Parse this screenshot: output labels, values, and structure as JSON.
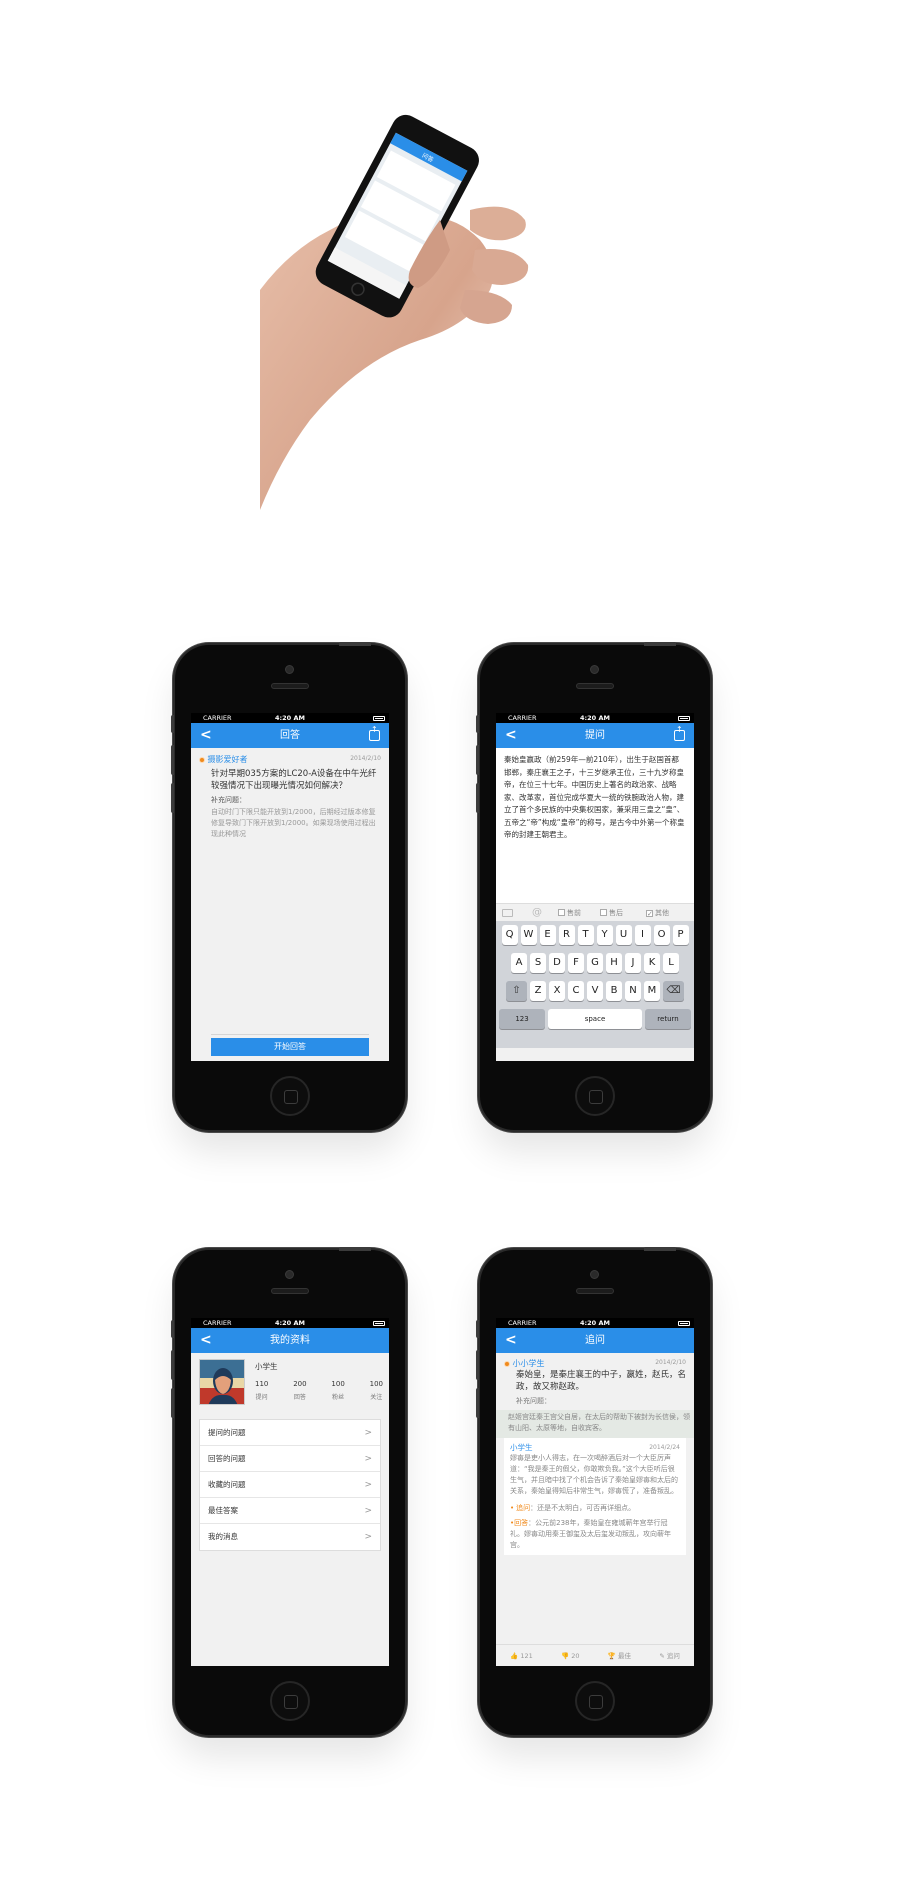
{
  "hero_phone": {
    "nav_title": "问答"
  },
  "status": {
    "carrier": "CARRIER",
    "time": "4:20 AM"
  },
  "screen_answer": {
    "nav_title": "回答",
    "user": "摄影爱好者",
    "date": "2014/2/10",
    "question": "针对早期035方案的LC20-A设备在中午光纤较强情况下出现曝光情况如何解决？",
    "supplement_label": "补充问题：",
    "supplement": "自动时门下限只能开放到1/2000，后期经过版本修复修复导致门下限开放到1/2000。如果现场使用过程出现此种情况",
    "start_button": "开始回答"
  },
  "screen_ask": {
    "nav_title": "提问",
    "body": "秦始皇嬴政（前259年—前210年），出生于赵国首都邯郸，秦庄襄王之子，十三岁继承王位，三十九岁称皇帝，在位三十七年。中国历史上著名的政治家、战略家、改革家，首位完成华夏大一统的铁腕政治人物，建立了首个多民族的中央集权国家，兼采用三皇之“皇”、五帝之“帝”构成“皇帝”的称号，是古今中外第一个称皇帝的封建王朝君主。",
    "options": [
      "售前",
      "售后",
      "其他"
    ],
    "checked_option": "其他",
    "keyboard": {
      "row1": [
        "Q",
        "W",
        "E",
        "R",
        "T",
        "Y",
        "U",
        "I",
        "O",
        "P"
      ],
      "row2": [
        "A",
        "S",
        "D",
        "F",
        "G",
        "H",
        "J",
        "K",
        "L"
      ],
      "row3": [
        "Z",
        "X",
        "C",
        "V",
        "B",
        "N",
        "M"
      ],
      "k123": "123",
      "space": "space",
      "return": "return"
    }
  },
  "screen_profile": {
    "nav_title": "我的资料",
    "name": "小学生",
    "stats": [
      {
        "value": "110",
        "label": "提问"
      },
      {
        "value": "200",
        "label": "回答"
      },
      {
        "value": "100",
        "label": "粉丝"
      },
      {
        "value": "100",
        "label": "关注"
      }
    ],
    "menu": [
      "提问的问题",
      "回答的问题",
      "收藏的问题",
      "最佳答案",
      "我的消息"
    ]
  },
  "screen_followup": {
    "nav_title": "追问",
    "user": "小小学生",
    "date": "2014/2/10",
    "question": "秦始皇，是秦庄襄王的中子，嬴姓，赵氏，名政，故又称赵政。",
    "supplement_label": "补充问题：",
    "supplement": "赵姬宫廷秦王宫父自居，在太后的帮助下被封为长信侯，领有山阳、太原等地，自收宾客。",
    "answer_user": "小学生",
    "answer_date": "2014/2/24",
    "answer": "嫪毐是吏小人得志，在一次喝醉酒后对一个大臣厉声道：“我是秦王的假父，你敢欺负我。”这个大臣听后很生气，并且暗中找了个机会告诉了秦始皇嫪毐和太后的关系，秦始皇得知后非常生气，嫪毐慌了，准备叛乱。",
    "follow_tag": "追问",
    "follow_text": "：还是不太明白，可否再详细点。",
    "reply_tag": "回答",
    "reply_text": "：公元前238年，秦始皇在雍城蕲年宫举行冠礼。嫪毐动用秦王御玺及太后玺发动叛乱，攻向蕲年宫。",
    "actions": [
      "121",
      "20",
      "最佳",
      "追问"
    ]
  }
}
